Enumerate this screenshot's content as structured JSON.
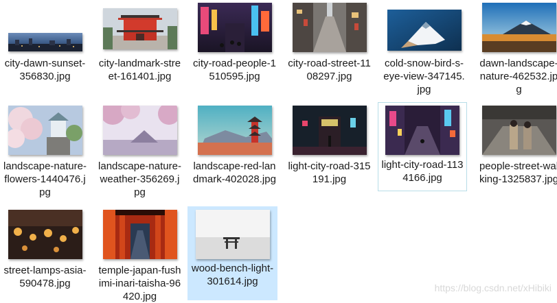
{
  "files": [
    {
      "name": "city-dawn-sunset-356830.jpg",
      "thumb": "city-dawn-sunset-thumbnail"
    },
    {
      "name": "city-landmark-street-161401.jpg",
      "thumb": "city-landmark-street-thumbnail"
    },
    {
      "name": "city-road-people-1510595.jpg",
      "thumb": "city-road-people-thumbnail"
    },
    {
      "name": "city-road-street-1108297.jpg",
      "thumb": "city-road-street-thumbnail"
    },
    {
      "name": "cold-snow-bird-s-eye-view-347145.jpg",
      "thumb": "cold-snow-bird-s-eye-view-thumbnail"
    },
    {
      "name": "dawn-landscape-nature-462532.jpg",
      "thumb": "dawn-landscape-nature-thumbnail"
    },
    {
      "name": "landscape-nature-flowers-1440476.jpg",
      "thumb": "landscape-nature-flowers-thumbnail"
    },
    {
      "name": "landscape-nature-weather-356269.jpg",
      "thumb": "landscape-nature-weather-thumbnail"
    },
    {
      "name": "landscape-red-landmark-402028.jpg",
      "thumb": "landscape-red-landmark-thumbnail"
    },
    {
      "name": "light-city-road-315191.jpg",
      "thumb": "light-city-road-315191-thumbnail"
    },
    {
      "name": "light-city-road-1134166.jpg",
      "thumb": "light-city-road-1134166-thumbnail",
      "state": "hover"
    },
    {
      "name": "people-street-walking-1325837.jpg",
      "thumb": "people-street-walking-thumbnail"
    },
    {
      "name": "street-lamps-asia-590478.jpg",
      "thumb": "street-lamps-asia-thumbnail"
    },
    {
      "name": "temple-japan-fushimi-inari-taisha-96420.jpg",
      "thumb": "temple-japan-fushimi-inari-thumbnail"
    },
    {
      "name": "wood-bench-light-301614.jpg",
      "thumb": "wood-bench-light-thumbnail",
      "state": "selected"
    }
  ],
  "watermark": "https://blog.csdn.net/xHibiki",
  "colors": {
    "selected_bg": "#cce8ff",
    "hover_border": "#b7dde8",
    "text": "#1a1a1a"
  }
}
